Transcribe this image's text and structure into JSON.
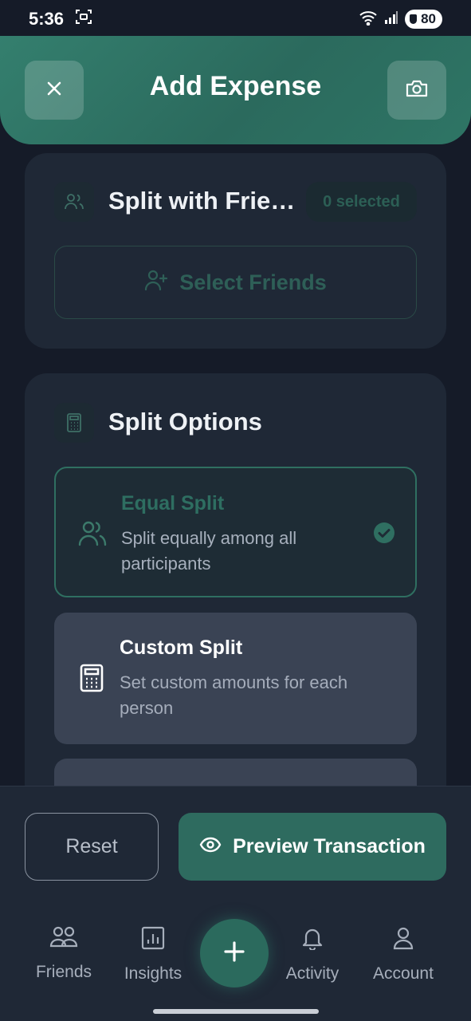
{
  "status_bar": {
    "time": "5:36",
    "battery": "80"
  },
  "header": {
    "title": "Add Expense",
    "close_icon": "close-icon",
    "camera_icon": "camera-icon"
  },
  "friends_card": {
    "title": "Split with Frie…",
    "selected_count": "0 selected",
    "select_button_label": "Select Friends"
  },
  "options_card": {
    "title": "Split Options",
    "options": [
      {
        "title": "Equal Split",
        "description": "Split equally among all participants",
        "selected": true
      },
      {
        "title": "Custom Split",
        "description": "Set custom amounts for each person",
        "selected": false
      }
    ]
  },
  "actions": {
    "reset_label": "Reset",
    "preview_label": "Preview Transaction"
  },
  "bottom_nav": {
    "items": [
      {
        "label": "Friends",
        "icon": "friends-icon"
      },
      {
        "label": "Insights",
        "icon": "insights-icon"
      },
      {
        "label": "Activity",
        "icon": "bell-icon"
      },
      {
        "label": "Account",
        "icon": "account-icon"
      }
    ],
    "fab_icon": "plus-icon"
  },
  "colors": {
    "accent": "#2e6b5f",
    "background": "#151b28",
    "card": "#1f2836"
  }
}
